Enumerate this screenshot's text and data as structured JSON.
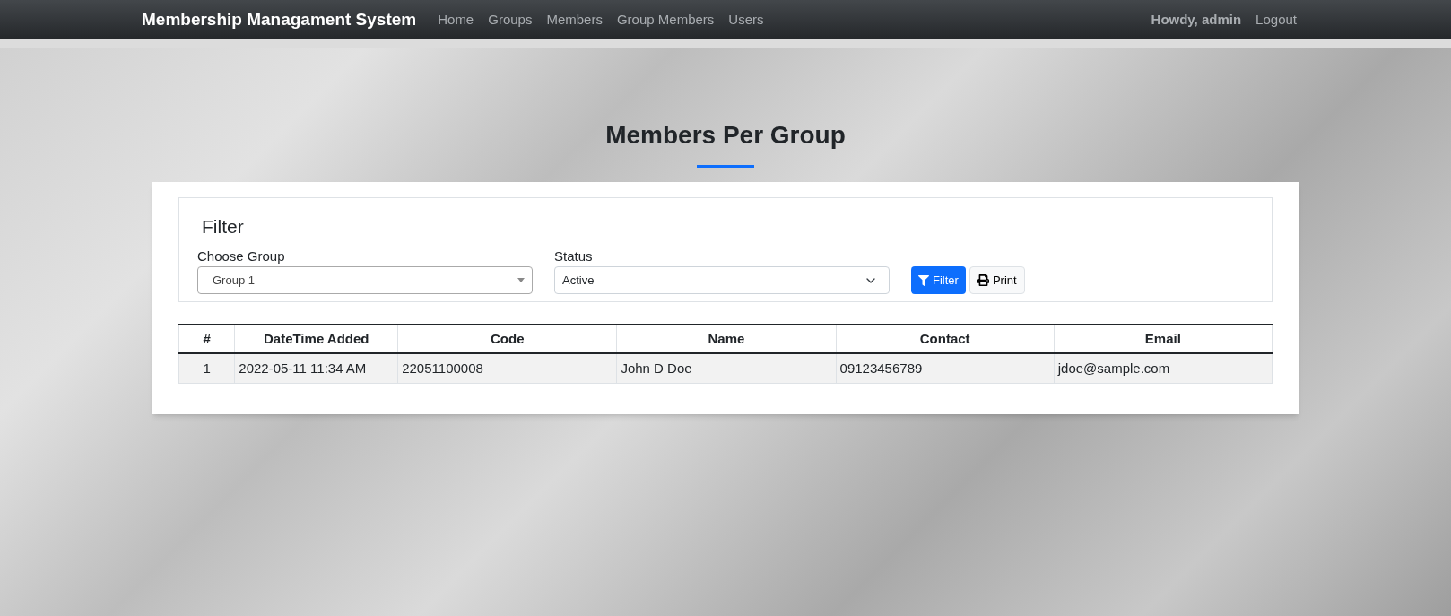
{
  "navbar": {
    "brand": "Membership Managament System",
    "links": [
      {
        "label": "Home",
        "selected": false
      },
      {
        "label": "Groups",
        "selected": false
      },
      {
        "label": "Members",
        "selected": false
      },
      {
        "label": "Group Members",
        "selected": false
      },
      {
        "label": "Users",
        "selected": false
      }
    ],
    "greeting": "Howdy, admin",
    "logout": "Logout"
  },
  "page_title": "Members Per Group",
  "filter": {
    "title": "Filter",
    "fields": [
      {
        "label": "Choose Group",
        "value": "Group 1",
        "kind": "select2"
      },
      {
        "label": "Status",
        "value": "Active",
        "kind": "native"
      }
    ],
    "buttons": [
      {
        "label": "Filter",
        "kind": "primary"
      },
      {
        "label": "Print",
        "kind": "light"
      }
    ]
  },
  "table": {
    "columns": [
      "#",
      "DateTime Added",
      "Code",
      "Name",
      "Contact",
      "Email"
    ],
    "rows": [
      [
        "1",
        "2022-05-11 11:34 AM",
        "22051100008",
        "John D Doe",
        "09123456789",
        "jdoe@sample.com"
      ]
    ]
  }
}
